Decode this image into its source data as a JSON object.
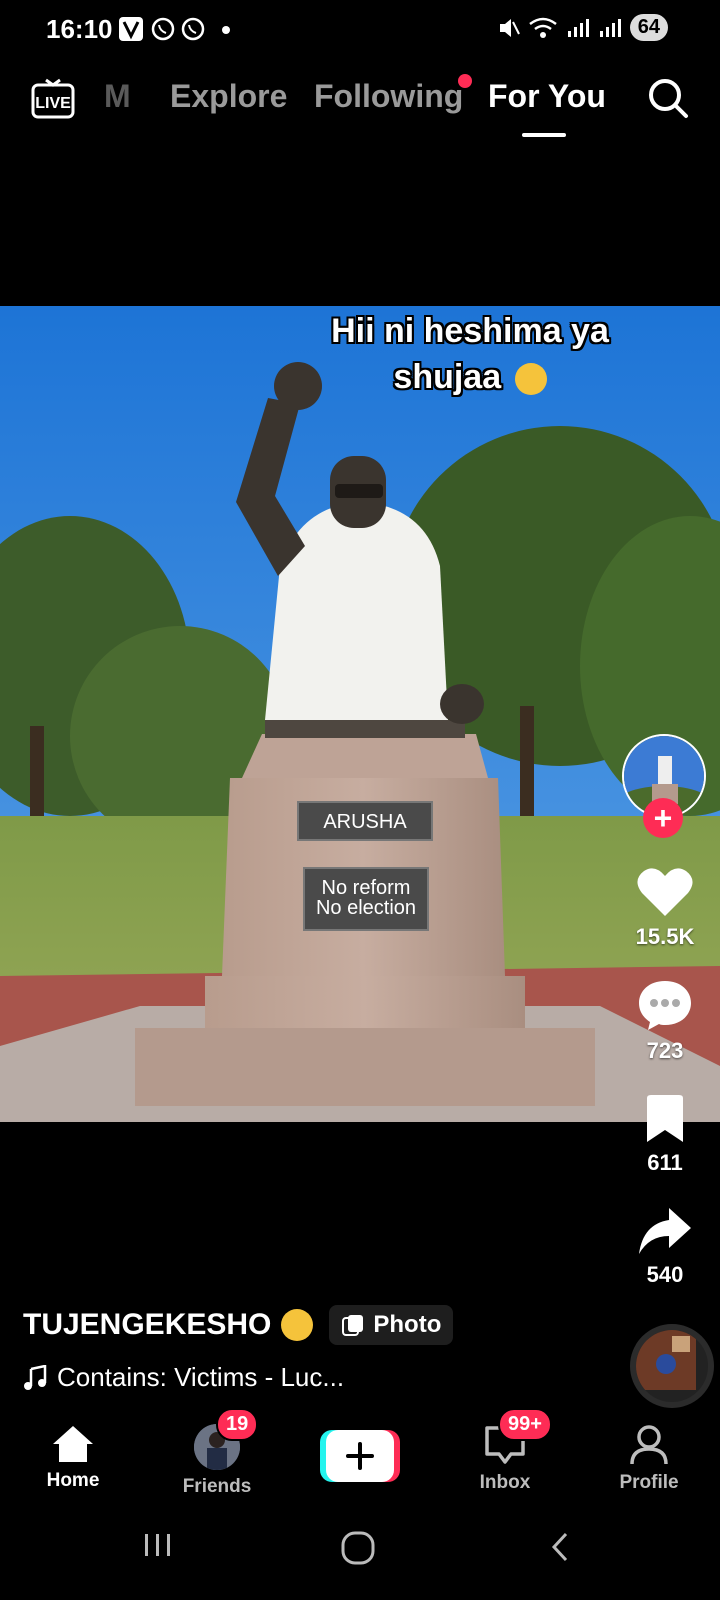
{
  "status_bar": {
    "time": "16:10",
    "battery": "64"
  },
  "top_nav": {
    "tabs": [
      {
        "label": "M"
      },
      {
        "label": "Explore"
      },
      {
        "label": "Following"
      },
      {
        "label": "For You",
        "active": true
      }
    ]
  },
  "post": {
    "overlay_caption": "Hii ni heshima ya shujaa",
    "plaque_title": "ARUSHA",
    "plaque_line1": "No reform",
    "plaque_line2": "No election",
    "likes": "15.5K",
    "comments": "723",
    "saves": "611",
    "shares": "540",
    "username": "TUJENGEKESHO",
    "badge_label": "Photo",
    "music": "Contains: Victims - Luc..."
  },
  "bottom_nav": {
    "home": "Home",
    "friends": "Friends",
    "friends_badge": "19",
    "inbox": "Inbox",
    "inbox_badge": "99+",
    "profile": "Profile"
  },
  "colors": {
    "accent": "#fe2c55",
    "inactive_tab": "#9a9a9a",
    "create_left": "#25f4ee",
    "create_right": "#fe2c55"
  }
}
